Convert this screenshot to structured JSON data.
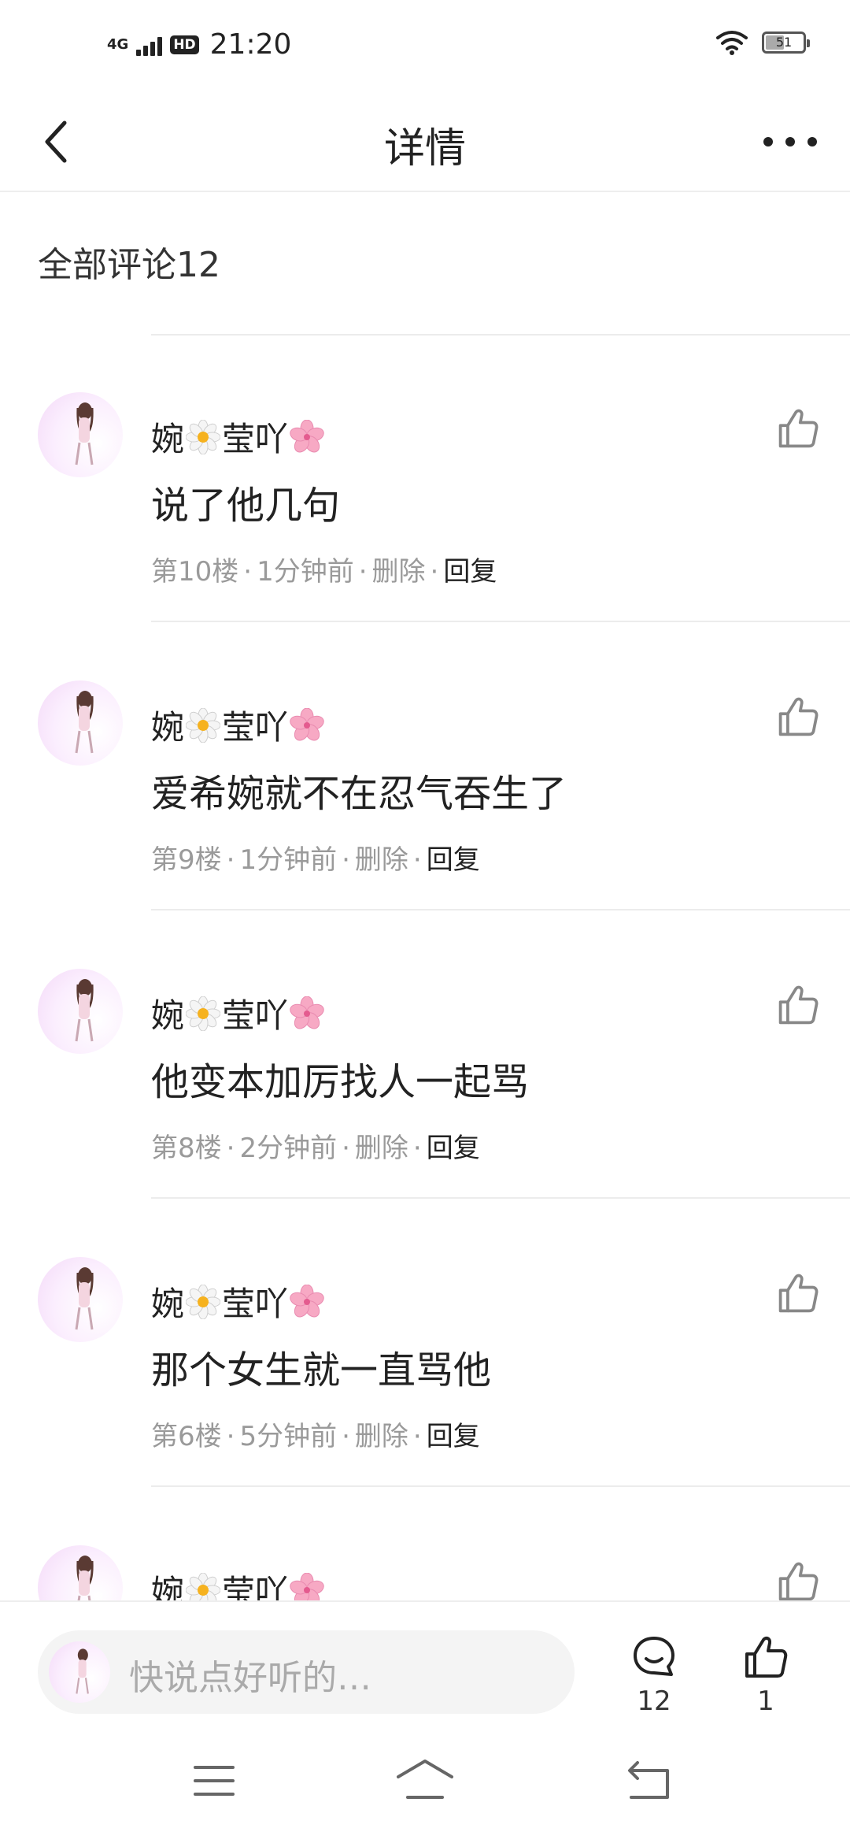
{
  "status_bar": {
    "network": "4G",
    "hd": "HD",
    "time": "21:20",
    "battery": "51",
    "battery_level": 0.51,
    "icons": [
      "signal-icon",
      "wifi-icon",
      "battery-icon"
    ]
  },
  "nav": {
    "title": "详情",
    "back_icon": "chevron-left-icon",
    "more_icon": "more-horizontal-icon"
  },
  "comments_header": "全部评论12",
  "comments": [
    {
      "name": "婉",
      "name2": "莹吖",
      "text": "说了他几句",
      "floor": "第10楼",
      "time": "1分钟前",
      "delete": "删除",
      "reply": "回复"
    },
    {
      "name": "婉",
      "name2": "莹吖",
      "text": "爱希婉就不在忍气吞生了",
      "floor": "第9楼",
      "time": "1分钟前",
      "delete": "删除",
      "reply": "回复"
    },
    {
      "name": "婉",
      "name2": "莹吖",
      "text": "他变本加厉找人一起骂",
      "floor": "第8楼",
      "time": "2分钟前",
      "delete": "删除",
      "reply": "回复"
    },
    {
      "name": "婉",
      "name2": "莹吖",
      "text": "那个女生就一直骂他",
      "floor": "第6楼",
      "time": "5分钟前",
      "delete": "删除",
      "reply": "回复"
    },
    {
      "name": "婉",
      "name2": "莹吖",
      "text": "",
      "floor": "",
      "time": "",
      "delete": "",
      "reply": ""
    }
  ],
  "bottom_bar": {
    "placeholder": "快说点好听的…",
    "comment_count": "12",
    "like_count": "1"
  },
  "system_nav": [
    "menu-icon",
    "home-icon",
    "back-icon"
  ]
}
